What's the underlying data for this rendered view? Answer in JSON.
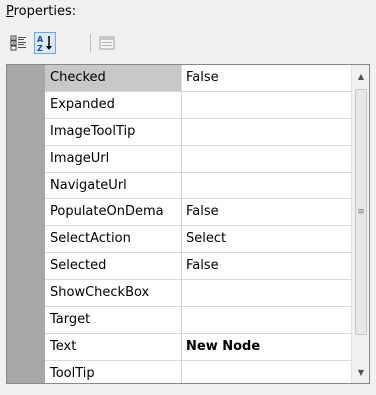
{
  "panel": {
    "title_underlined": "P",
    "title_rest": "roperties:"
  },
  "toolbar": {
    "categorized_icon": "categorized-icon",
    "alphabetical_icon": "alphabetical-sort-icon",
    "property_pages_icon": "property-pages-icon"
  },
  "properties": [
    {
      "name": "Checked",
      "value": "False"
    },
    {
      "name": "Expanded",
      "value": ""
    },
    {
      "name": "ImageToolTip",
      "value": ""
    },
    {
      "name": "ImageUrl",
      "value": ""
    },
    {
      "name": "NavigateUrl",
      "value": ""
    },
    {
      "name": "PopulateOnDema",
      "value": "False"
    },
    {
      "name": "SelectAction",
      "value": "Select"
    },
    {
      "name": "Selected",
      "value": "False"
    },
    {
      "name": "ShowCheckBox",
      "value": ""
    },
    {
      "name": "Target",
      "value": ""
    },
    {
      "name": "Text",
      "value": "New Node"
    },
    {
      "name": "ToolTip",
      "value": ""
    }
  ],
  "scrollbar": {
    "up_glyph": "▲",
    "down_glyph": "▼",
    "grip_glyph": "≡"
  }
}
